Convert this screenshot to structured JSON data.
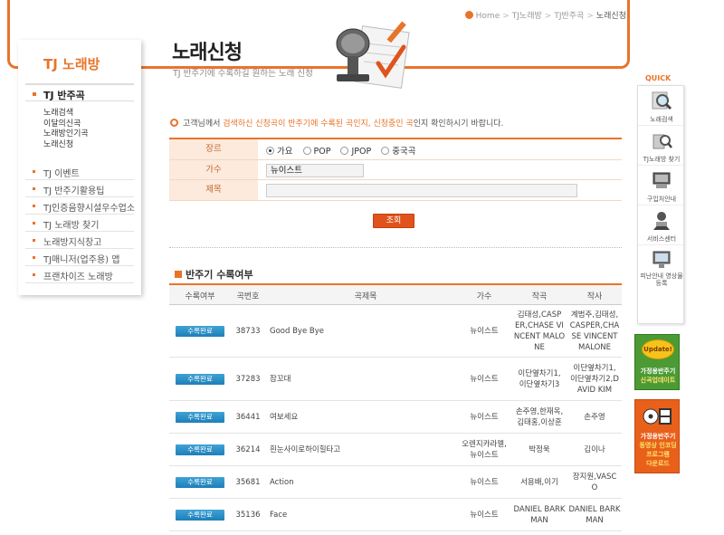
{
  "breadcrumb": [
    "Home",
    "TJ노래방",
    "TJ반주곡",
    "노래신청"
  ],
  "sidebar": {
    "brand": "TJ 노래방",
    "main": "TJ 반주곡",
    "sub": [
      "노래검색",
      "이달의신곡",
      "노래방인기곡",
      "노래신청"
    ],
    "items": [
      "TJ 이벤트",
      "TJ 반주기활용팁",
      "TJ인증음향시설우수업소",
      "TJ 노래방 찾기",
      "노래방지식창고",
      "TJ매니저(업주용) 앱",
      "프랜차이즈 노래방"
    ]
  },
  "header": {
    "title": "노래신청",
    "subtitle": "TJ 반주기에 수록하길 원하는 노래 신청"
  },
  "notice": {
    "pre": "고객님께서 ",
    "hl1": "검색하신 신청곡이 반주기에 수록된 곡인지, 신청중인 곡",
    "post": "인지 확인하시기 바랍니다."
  },
  "form": {
    "genre_label": "장르",
    "genres": [
      "가요",
      "POP",
      "JPOP",
      "중국곡"
    ],
    "selected_genre": "가요",
    "singer_label": "가수",
    "singer_value": "뉴이스트",
    "title_label": "제목",
    "title_value": "",
    "search_button": "조회"
  },
  "results": {
    "title": "반주기 수록여부",
    "columns": [
      "수록여부",
      "곡번호",
      "곡제목",
      "가수",
      "작곡",
      "작사"
    ],
    "rows": [
      {
        "status": "수록완료",
        "no": "38733",
        "title": "Good Bye Bye",
        "singer": [
          "뉴이스트"
        ],
        "composer": [
          "김태성,CASP",
          "ER,CHASE VI",
          "NCENT MALO",
          "NE"
        ],
        "lyricist": [
          "계범주,김태성,",
          "CASPER,CHA",
          "SE VINCENT",
          "MALONE"
        ]
      },
      {
        "status": "수록완료",
        "no": "37283",
        "title": "잠꼬대",
        "singer": [
          "뉴이스트"
        ],
        "composer": [
          "이단옆차기1,",
          "이단옆차기3"
        ],
        "lyricist": [
          "이단옆차기1,",
          "이단옆차기2,D",
          "AVID KIM"
        ]
      },
      {
        "status": "수록완료",
        "no": "36441",
        "title": "여보세요",
        "singer": [
          "뉴이스트"
        ],
        "composer": [
          "손주영,한재옥,",
          "김태홍,이상훈"
        ],
        "lyricist": [
          "손주영"
        ]
      },
      {
        "status": "수록완료",
        "no": "36214",
        "title": "흰눈사이로하이힐타고",
        "singer": [
          "오렌지캬라멜,",
          "뉴이스트"
        ],
        "composer": [
          "박정욱"
        ],
        "lyricist": [
          "김이나"
        ]
      },
      {
        "status": "수록완료",
        "no": "35681",
        "title": "Action",
        "singer": [
          "뉴이스트"
        ],
        "composer": [
          "서용배,이기"
        ],
        "lyricist": [
          "장지원,VASC",
          "O"
        ]
      },
      {
        "status": "수록완료",
        "no": "35136",
        "title": "Face",
        "singer": [
          "뉴이스트"
        ],
        "composer": [
          "DANIEL BARK",
          "MAN"
        ],
        "lyricist": [
          "DANIEL BARK",
          "MAN"
        ]
      }
    ]
  },
  "quick": {
    "label": "QUICK",
    "items": [
      "노래검색",
      "TJ노래방 찾기",
      "구입처안내",
      "서비스센터",
      "피난안내 영상물등록"
    ],
    "banner1": [
      "Update!",
      "가정용반주기",
      "신곡업데이트"
    ],
    "banner2": [
      "가정용반주기",
      "동영상 인코딩",
      "프로그램",
      "다운로드"
    ]
  },
  "colors": {
    "accent": "#e8742a",
    "badge": "#1e7eb8"
  }
}
